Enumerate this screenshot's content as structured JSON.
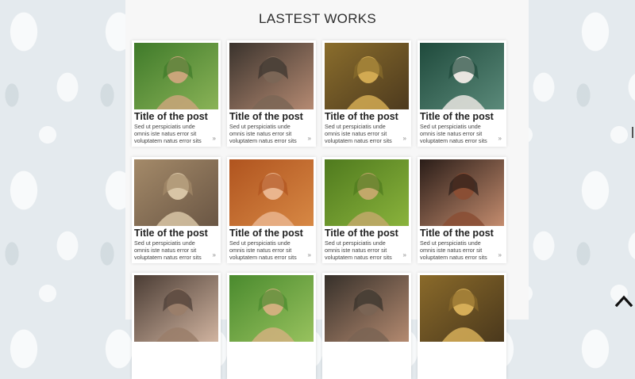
{
  "section": {
    "heading": "LASTEST WORKS"
  },
  "posts": [
    {
      "title": "Title of the post",
      "excerpt": "Sed ut perspiciatis unde omnis iste natus error sit voluptatem natus error sits",
      "more_icon": "double-chevron-right-icon",
      "photo": "blonde woman holding flower in green field",
      "colors": [
        "#3f7a2a",
        "#c9a57a",
        "#8ab357"
      ]
    },
    {
      "title": "Title of the post",
      "excerpt": "Sed ut perspiciatis unde omnis iste natus error sit voluptatem natus error sits",
      "more_icon": "double-chevron-right-icon",
      "photo": "girl with flower crown next to dark horse",
      "colors": [
        "#3a332d",
        "#7b6656",
        "#b58a72"
      ]
    },
    {
      "title": "Title of the post",
      "excerpt": "Sed ut perspiciatis unde omnis iste natus error sit voluptatem natus error sits",
      "more_icon": "double-chevron-right-icon",
      "photo": "woman in golden sunlit field",
      "colors": [
        "#8a6d2c",
        "#d2aa52",
        "#4d3a1e"
      ]
    },
    {
      "title": "Title of the post",
      "excerpt": "Sed ut perspiciatis unde omnis iste natus error sit voluptatem natus error sits",
      "more_icon": "double-chevron-right-icon",
      "photo": "woman in white dress sitting by pond",
      "colors": [
        "#1f4a3c",
        "#e9e5e0",
        "#5b8a7a"
      ]
    },
    {
      "title": "Title of the post",
      "excerpt": "Sed ut perspiciatis unde omnis iste natus error sit voluptatem natus error sits",
      "more_icon": "double-chevron-right-icon",
      "photo": "woman seated at table in warm room",
      "colors": [
        "#a48a69",
        "#d8c5a6",
        "#6a5644"
      ]
    },
    {
      "title": "Title of the post",
      "excerpt": "Sed ut perspiciatis unde omnis iste natus error sit voluptatem natus error sits",
      "more_icon": "double-chevron-right-icon",
      "photo": "red-haired woman close-up portrait",
      "colors": [
        "#b0541f",
        "#eab58e",
        "#d78844"
      ]
    },
    {
      "title": "Title of the post",
      "excerpt": "Sed ut perspiciatis unde omnis iste natus error sit voluptatem natus error sits",
      "more_icon": "double-chevron-right-icon",
      "photo": "child with straw hat among ferns",
      "colors": [
        "#4f7a1e",
        "#c2a86a",
        "#8ab33c"
      ]
    },
    {
      "title": "Title of the post",
      "excerpt": "Sed ut perspiciatis unde omnis iste natus error sit voluptatem natus error sits",
      "more_icon": "double-chevron-right-icon",
      "photo": "woman in dark setting with red hair",
      "colors": [
        "#2a1d18",
        "#8a4e34",
        "#c48c6e"
      ]
    },
    {
      "title": "",
      "excerpt": "",
      "more_icon": "",
      "photo": "dark-haired woman portrait",
      "colors": [
        "#4a3c34",
        "#9a7e6a",
        "#d1b4a0"
      ]
    },
    {
      "title": "",
      "excerpt": "",
      "more_icon": "",
      "photo": "blonde woman in green field",
      "colors": [
        "#4a8a2e",
        "#d1b07e",
        "#98c25e"
      ]
    },
    {
      "title": "",
      "excerpt": "",
      "more_icon": "",
      "photo": "girl with horse",
      "colors": [
        "#36302a",
        "#7a6454",
        "#b48a70"
      ]
    },
    {
      "title": "",
      "excerpt": "",
      "more_icon": "",
      "photo": "woman in golden field",
      "colors": [
        "#8a6a2a",
        "#d6ae58",
        "#4a381c"
      ]
    }
  ],
  "scroll_top": {
    "icon": "chevron-up-icon"
  }
}
